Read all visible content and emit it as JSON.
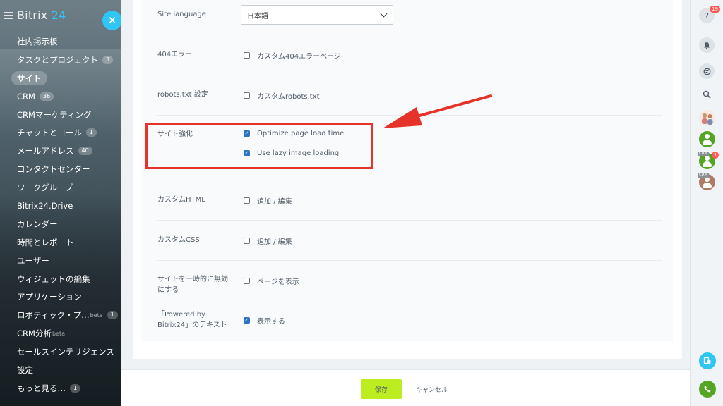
{
  "logo": {
    "name": "Bitrix",
    "number": "24"
  },
  "sidebar": {
    "items": [
      {
        "label": "社内掲示板",
        "count": "",
        "sup": ""
      },
      {
        "label": "タスクとプロジェクト",
        "count": "3",
        "sup": ""
      },
      {
        "label": "サイト",
        "count": "",
        "sup": "",
        "active": true
      },
      {
        "label": "CRM",
        "count": "36",
        "sup": ""
      },
      {
        "label": "CRMマーケティング",
        "count": "",
        "sup": ""
      },
      {
        "label": "チャットとコール",
        "count": "1",
        "sup": ""
      },
      {
        "label": "メールアドレス",
        "count": "40",
        "sup": ""
      },
      {
        "label": "コンタクトセンター",
        "count": "",
        "sup": ""
      },
      {
        "label": "ワークグループ",
        "count": "",
        "sup": ""
      },
      {
        "label": "Bitrix24.Drive",
        "count": "",
        "sup": ""
      },
      {
        "label": "カレンダー",
        "count": "",
        "sup": ""
      },
      {
        "label": "時間とレポート",
        "count": "",
        "sup": ""
      },
      {
        "label": "ユーザー",
        "count": "",
        "sup": ""
      },
      {
        "label": "ウィジェットの編集",
        "count": "",
        "sup": ""
      },
      {
        "label": "アプリケーション",
        "count": "",
        "sup": ""
      },
      {
        "label": "ロボティック・プ…",
        "count": "1",
        "sup": "beta"
      },
      {
        "label": "CRM分析",
        "count": "",
        "sup": "beta"
      },
      {
        "label": "セールスインテリジェンス",
        "count": "",
        "sup": ""
      },
      {
        "label": "設定",
        "count": "",
        "sup": ""
      },
      {
        "label": "もっと見る…",
        "count": "1",
        "sup": ""
      }
    ],
    "close_symbol": "✕"
  },
  "settings": {
    "site_language": {
      "label": "Site language",
      "value": "日本語"
    },
    "error404": {
      "label": "404エラー",
      "option": "カスタム404エラーページ",
      "checked": false
    },
    "robots": {
      "label": "robots.txt 設定",
      "option": "カスタムrobots.txt",
      "checked": false
    },
    "enhance": {
      "label": "サイト強化",
      "option1": "Optimize page load time",
      "option1_checked": true,
      "option2": "Use lazy image loading",
      "option2_checked": true
    },
    "custom_html": {
      "label": "カスタムHTML",
      "option": "追加 / 編集",
      "checked": false
    },
    "custom_css": {
      "label": "カスタムCSS",
      "option": "追加 / 編集",
      "checked": false
    },
    "disable": {
      "label_line1": "サイトを一時的に無効",
      "label_line2": "にする",
      "option": "ページを表示",
      "checked": false
    },
    "powered": {
      "label_line1": "「Powered by",
      "label_line2": "Bitrix24」のテキスト",
      "option": "表示する",
      "checked": true
    }
  },
  "footer": {
    "save_label": "保存",
    "cancel_label": "キャンセル"
  },
  "rightbar": {
    "help_badge": "19",
    "crm_tag": "CRM",
    "crm_badge": "1",
    "icons": [
      "help-icon",
      "bell-icon",
      "chat-icon",
      "search-icon",
      "contact-avatars",
      "open-lines-icon",
      "phone-icon"
    ]
  },
  "colors": {
    "accent": "#2fc6f6",
    "save": "#bbed21",
    "checkbox": "#2b73c5",
    "highlight": "#e5332a"
  }
}
